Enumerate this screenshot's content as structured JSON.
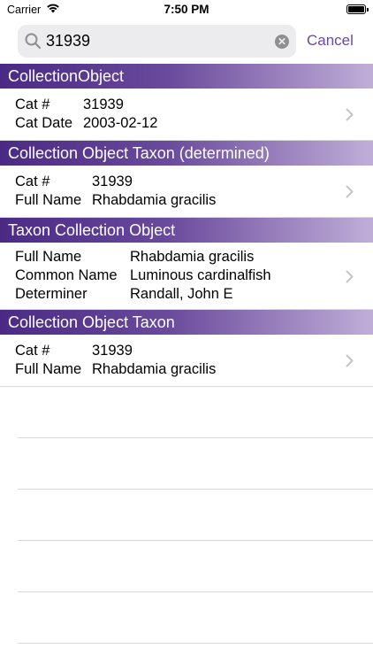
{
  "status_bar": {
    "carrier": "Carrier",
    "time": "7:50 PM"
  },
  "search": {
    "value": "31939",
    "cancel_label": "Cancel"
  },
  "sections": [
    {
      "title": "CollectionObject",
      "label_width": 77,
      "rows": [
        [
          {
            "label": "Cat #",
            "value": "31939"
          },
          {
            "label": "Cat Date",
            "value": "2003-02-12"
          }
        ]
      ]
    },
    {
      "title": "Collection Object Taxon (determined)",
      "label_width": 87,
      "rows": [
        [
          {
            "label": "Cat #",
            "value": "31939"
          },
          {
            "label": "Full Name",
            "value": "Rhabdamia gracilis"
          }
        ]
      ]
    },
    {
      "title": "Taxon Collection Object",
      "label_width": 130,
      "rows": [
        [
          {
            "label": "Full Name",
            "value": "Rhabdamia gracilis"
          },
          {
            "label": "Common Name",
            "value": "Luminous cardinalfish"
          },
          {
            "label": "Determiner",
            "value": "Randall, John E"
          }
        ]
      ]
    },
    {
      "title": "Collection Object Taxon",
      "label_width": 87,
      "rows": [
        [
          {
            "label": "Cat #",
            "value": "31939"
          },
          {
            "label": "Full Name",
            "value": "Rhabdamia gracilis"
          }
        ]
      ]
    }
  ],
  "empty_rows": 5,
  "icons": {
    "wifi": "wifi-icon",
    "battery": "battery-icon",
    "search": "search-icon",
    "clear": "clear-icon",
    "chevron": "chevron-right-icon"
  },
  "colors": {
    "accent": "#6a4a9c",
    "header_start": "#4a2a84",
    "header_end": "#c0aed8"
  }
}
